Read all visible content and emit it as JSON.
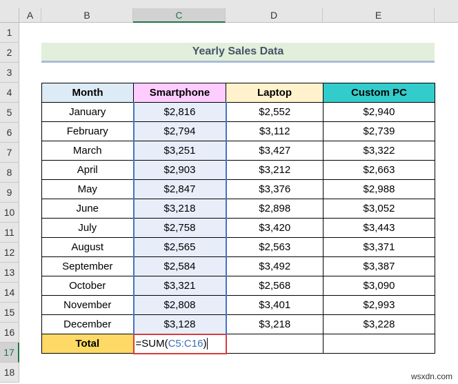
{
  "columns": [
    "A",
    "B",
    "C",
    "D",
    "E"
  ],
  "rows": [
    "1",
    "2",
    "3",
    "4",
    "5",
    "6",
    "7",
    "8",
    "9",
    "10",
    "11",
    "12",
    "13",
    "14",
    "15",
    "16",
    "17",
    "18"
  ],
  "title": "Yearly Sales Data",
  "headers": [
    "Month",
    "Smartphone",
    "Laptop",
    "Custom PC"
  ],
  "header_colors": [
    "#ddebf7",
    "#ffccff",
    "#fff2cc",
    "#33cccc"
  ],
  "data": [
    [
      "January",
      "$2,816",
      "$2,552",
      "$2,940"
    ],
    [
      "February",
      "$2,794",
      "$3,112",
      "$2,739"
    ],
    [
      "March",
      "$3,251",
      "$3,427",
      "$3,322"
    ],
    [
      "April",
      "$2,903",
      "$3,212",
      "$2,663"
    ],
    [
      "May",
      "$2,847",
      "$3,376",
      "$2,988"
    ],
    [
      "June",
      "$3,218",
      "$2,898",
      "$3,052"
    ],
    [
      "July",
      "$2,758",
      "$3,420",
      "$3,443"
    ],
    [
      "August",
      "$2,565",
      "$2,563",
      "$3,371"
    ],
    [
      "September",
      "$2,584",
      "$3,492",
      "$3,387"
    ],
    [
      "October",
      "$3,321",
      "$2,568",
      "$3,090"
    ],
    [
      "November",
      "$2,808",
      "$3,401",
      "$2,993"
    ],
    [
      "December",
      "$3,128",
      "$3,218",
      "$3,228"
    ]
  ],
  "total_label": "Total",
  "total_color": "#ffd966",
  "formula": {
    "prefix": "=SUM(",
    "ref": "C5:C16",
    "suffix": ")"
  },
  "watermark": "wsxdn.com"
}
